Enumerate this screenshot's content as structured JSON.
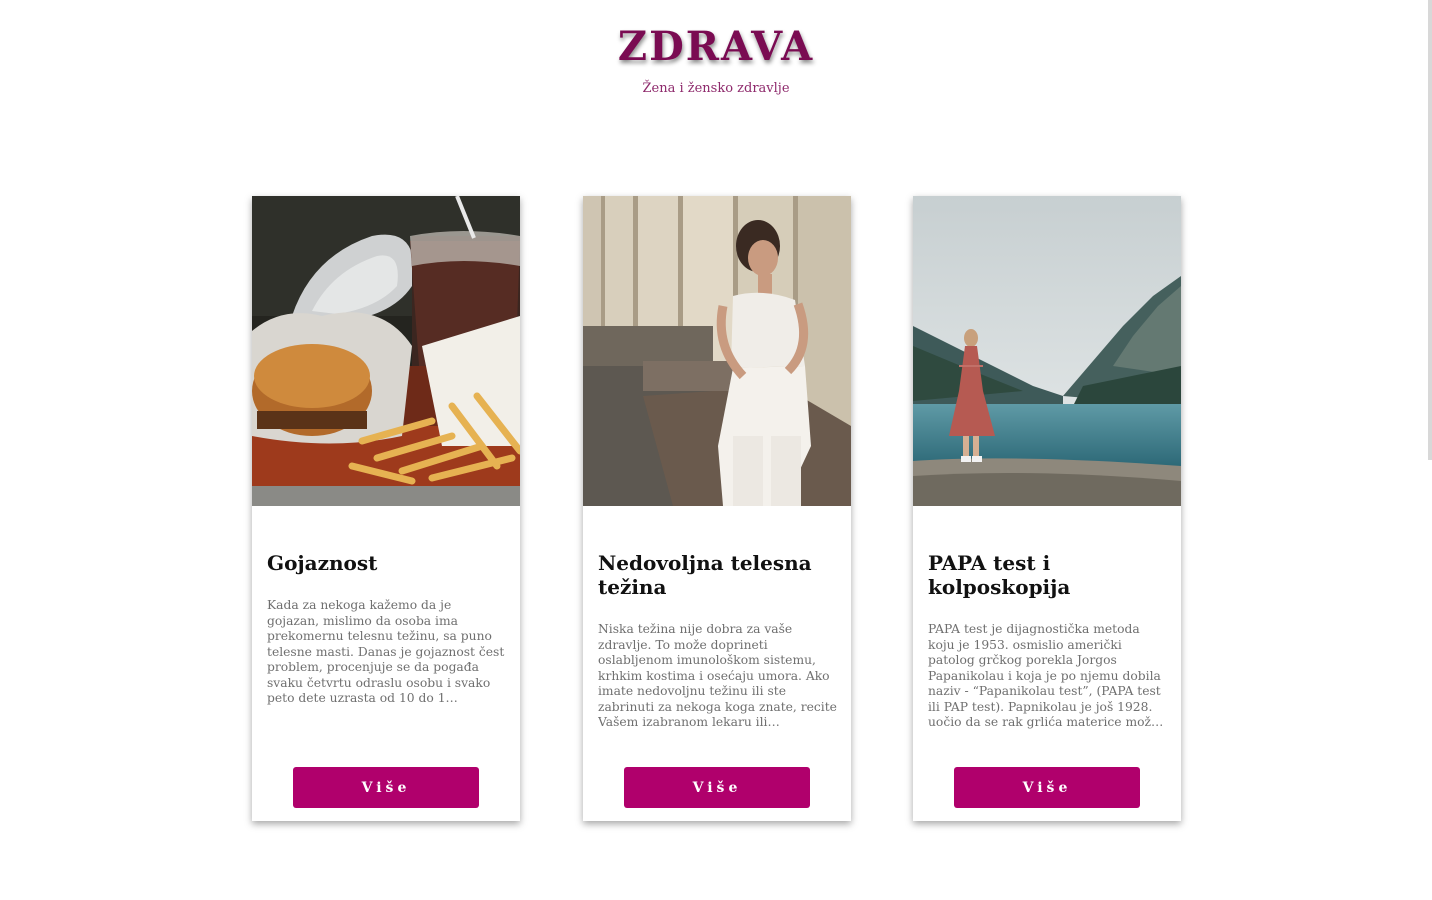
{
  "header": {
    "title": "ZDRAVA",
    "subtitle": "Žena i žensko zdravlje"
  },
  "colors": {
    "title": "#7a0b52",
    "subtitle": "#8e2a6c",
    "button": "#b0006c"
  },
  "cards": [
    {
      "image_icon": "fast-food-photo",
      "title": "Gojaznost",
      "text": "Kada za nekoga kažemo da je gojazan, mislimo da osoba ima prekomernu telesnu težinu, sa puno telesne masti. Danas je gojaznost čest problem, procenjuje se da pogađa svaku četvrtu odraslu osobu i svako peto dete uzrasta od 10 do 1…",
      "button_label": "Više"
    },
    {
      "image_icon": "woman-on-steps-photo",
      "title": "Nedovoljna telesna težina",
      "text": "Niska težina nije dobra za vaše zdravlje. To može doprineti oslabljenom imunološkom sistemu, krhkim kostima i osećaju umora. Ako imate nedovoljnu težinu ili ste zabrinuti za nekoga koga znate, recite Vašem izabranom lekaru ili…",
      "button_label": "Više"
    },
    {
      "image_icon": "woman-by-lake-photo",
      "title": "PAPA test i kolposkopija",
      "text": "PAPA test je dijagnostička metoda koju je 1953. osmislio američki patolog grčkog porekla Jorgos Papanikolau i koja je po njemu dobila naziv - “Papanikolau test”, (PAPA test ili PAP test). Papnikolau je još 1928. uočio da se rak grlića materice mož…",
      "button_label": "Više"
    }
  ]
}
